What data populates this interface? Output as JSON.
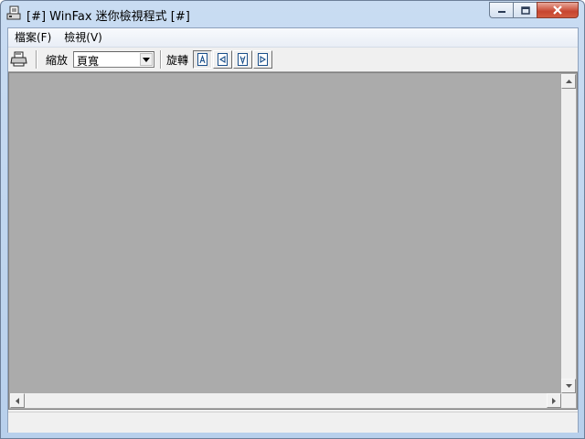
{
  "window": {
    "title": "[#] WinFax 迷你檢視程式 [#]",
    "icon": "fax-viewer-app-icon"
  },
  "menu": {
    "items": [
      {
        "label": "檔案(F)"
      },
      {
        "label": "檢視(V)"
      }
    ]
  },
  "toolbar": {
    "zoom_label": "縮放",
    "zoom_value": "頁寬",
    "rotate_label": "旋轉",
    "rotate_buttons": [
      {
        "icon": "rotate-upright-icon",
        "glyph": "A"
      },
      {
        "icon": "rotate-left-icon",
        "glyph": "◁"
      },
      {
        "icon": "rotate-180-icon",
        "glyph": "V"
      },
      {
        "icon": "rotate-right-icon",
        "glyph": "▷"
      }
    ]
  },
  "colors": {
    "document_background": "#ababab",
    "window_frame": "#b8d0ec",
    "close_button": "#c7452f"
  }
}
